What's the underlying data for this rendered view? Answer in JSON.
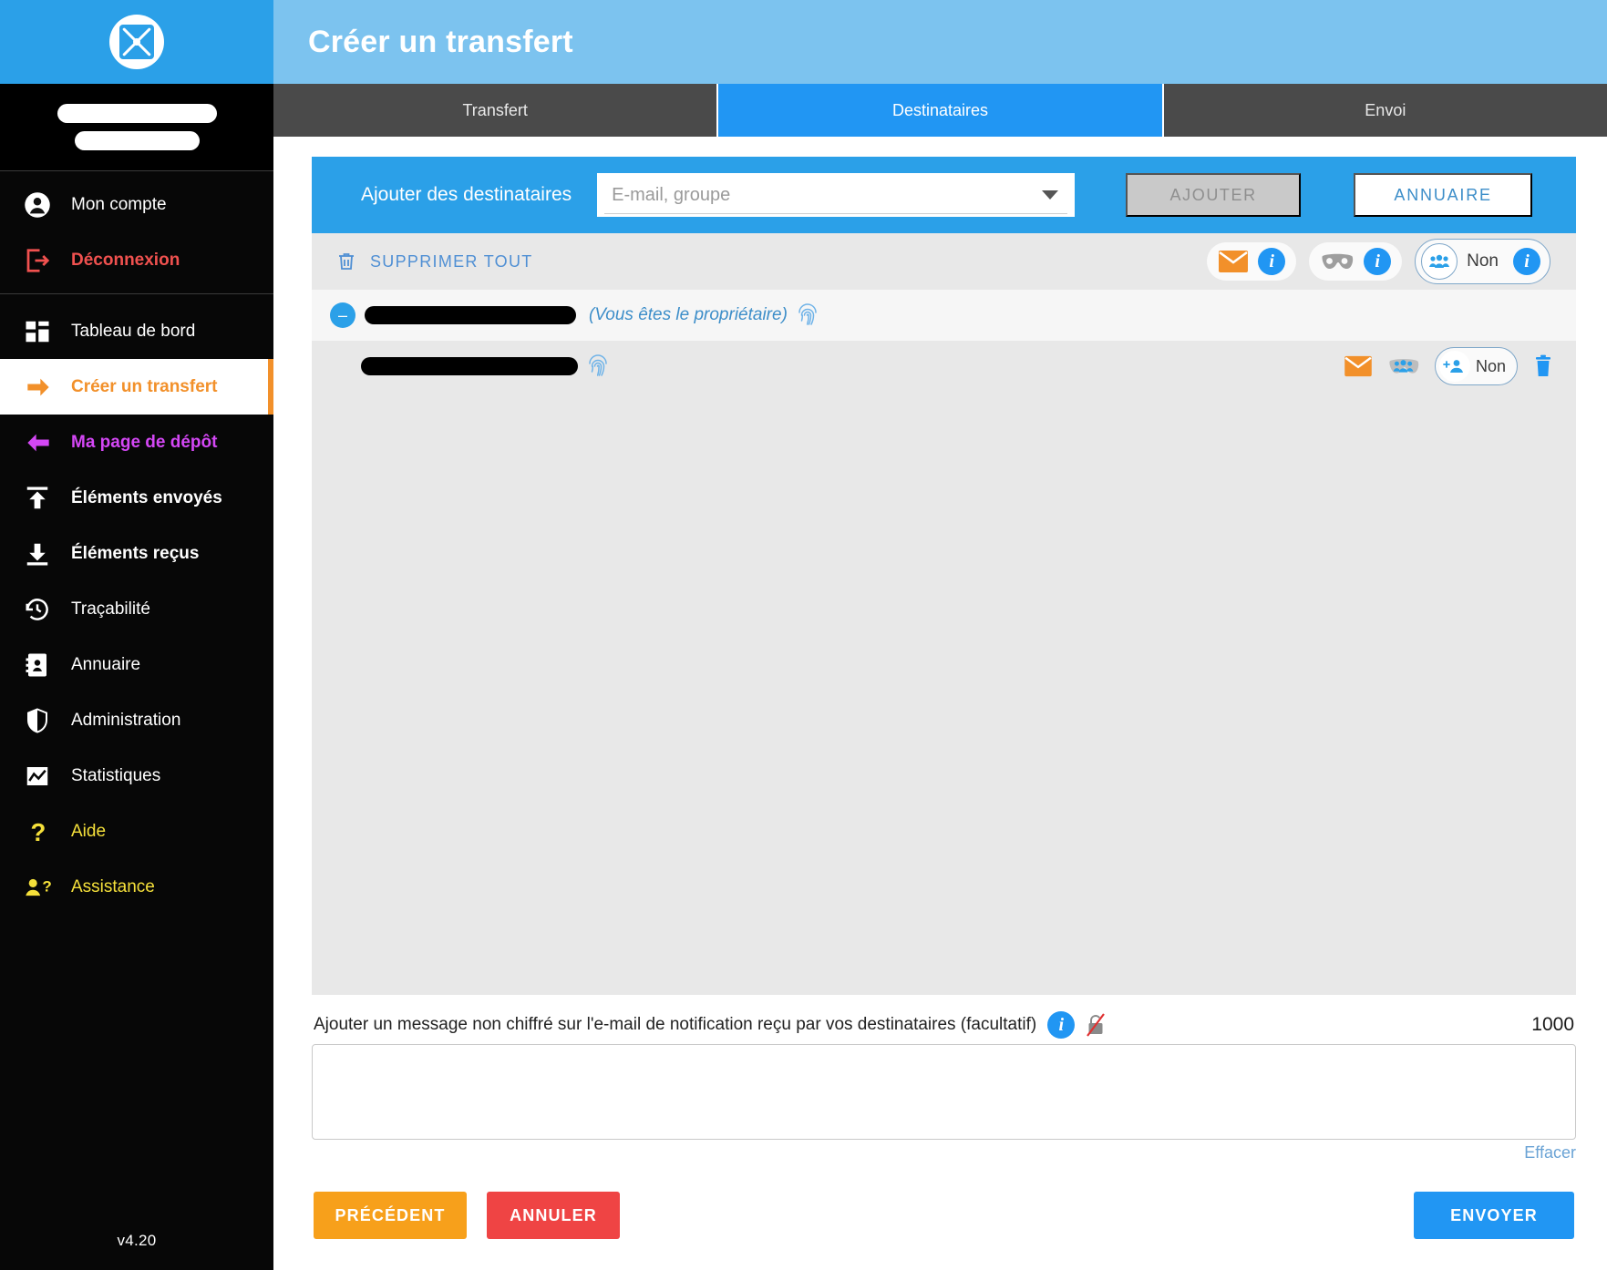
{
  "app": {
    "version": "v4.20",
    "logo_icon": "transfer-shield-logo-icon"
  },
  "colors": {
    "accent_blue": "#2ba0e8",
    "header_blue": "#7cc3ef",
    "tab_active": "#2196f3",
    "sidebar_bg": "#070707",
    "active_nav": "#f2902a",
    "logout_red": "#f0514f",
    "depot_purple": "#d447f5",
    "help_yellow": "#f5e03a",
    "panel_gray": "#e8e8e8",
    "btn_prev_orange": "#f7a01b",
    "btn_cancel_red": "#ef4444",
    "btn_send_blue": "#2196f3",
    "link_blue": "#4f8fd4",
    "envelope_orange": "#f2902a",
    "mask_gray": "#9e9e9e"
  },
  "sidebar": {
    "account_group": [
      {
        "label": "Mon compte",
        "icon": "user-circle-icon",
        "style": "plain"
      },
      {
        "label": "Déconnexion",
        "icon": "logout-icon",
        "style": "logout"
      }
    ],
    "nav_group": [
      {
        "label": "Tableau de bord",
        "icon": "dashboard-icon",
        "style": "plain"
      },
      {
        "label": "Créer un transfert",
        "icon": "arrow-right-icon",
        "style": "active"
      },
      {
        "label": "Ma page de dépôt",
        "icon": "arrow-left-icon",
        "style": "depot"
      },
      {
        "label": "Éléments envoyés",
        "icon": "upload-icon",
        "style": "bold"
      },
      {
        "label": "Éléments reçus",
        "icon": "download-icon",
        "style": "bold"
      },
      {
        "label": "Traçabilité",
        "icon": "history-clock-icon",
        "style": "plain"
      },
      {
        "label": "Annuaire",
        "icon": "address-book-icon",
        "style": "plain"
      },
      {
        "label": "Administration",
        "icon": "shield-icon",
        "style": "plain"
      },
      {
        "label": "Statistiques",
        "icon": "chart-line-icon",
        "style": "plain"
      },
      {
        "label": "Aide",
        "icon": "question-mark-icon",
        "style": "yellow"
      },
      {
        "label": "Assistance",
        "icon": "user-question-icon",
        "style": "yellow"
      }
    ]
  },
  "header": {
    "title": "Créer un transfert"
  },
  "tabs": [
    {
      "label": "Transfert",
      "active": false
    },
    {
      "label": "Destinataires",
      "active": true
    },
    {
      "label": "Envoi",
      "active": false
    }
  ],
  "add_recipients": {
    "label": "Ajouter des destinataires",
    "input_value": "",
    "input_placeholder": "E-mail, groupe",
    "dropdown_icon": "chevron-down-icon",
    "add_button": "AJOUTER",
    "add_button_disabled": true,
    "directory_button": "ANNUAIRE"
  },
  "toolbar": {
    "delete_all_label": "SUPPRIMER TOUT",
    "delete_all_icon": "trash-icon",
    "pills": [
      {
        "icon": "envelope-icon",
        "info_icon": "info-icon",
        "value": ""
      },
      {
        "icon": "mask-icon",
        "info_icon": "info-icon",
        "value": ""
      },
      {
        "icon": "group-people-icon",
        "info_icon": "info-icon",
        "value": "Non"
      }
    ]
  },
  "recipients": [
    {
      "is_owner": true,
      "remove_icon": "minus-circle-icon",
      "email_redacted": true,
      "owner_note": "(Vous êtes le propriétaire)",
      "fingerprint_icon": "fingerprint-icon"
    },
    {
      "is_owner": false,
      "email_redacted": true,
      "fingerprint_icon": "fingerprint-icon",
      "row_icons": [
        {
          "icon": "envelope-icon"
        },
        {
          "icon": "group-people-icon"
        }
      ],
      "group_pill": {
        "icon": "add-person-icon",
        "value": "Non"
      },
      "delete_icon": "trash-icon"
    }
  ],
  "message": {
    "label": "Ajouter un message non chiffré sur l'e-mail de notification reçu par vos destinataires (facultatif)",
    "info_icon": "info-icon",
    "unencrypted_icon": "unlocked-crossed-icon",
    "counter": "1000",
    "value": "",
    "clear_label": "Effacer"
  },
  "footer": {
    "previous": "PRÉCÉDENT",
    "cancel": "ANNULER",
    "send": "ENVOYER"
  }
}
